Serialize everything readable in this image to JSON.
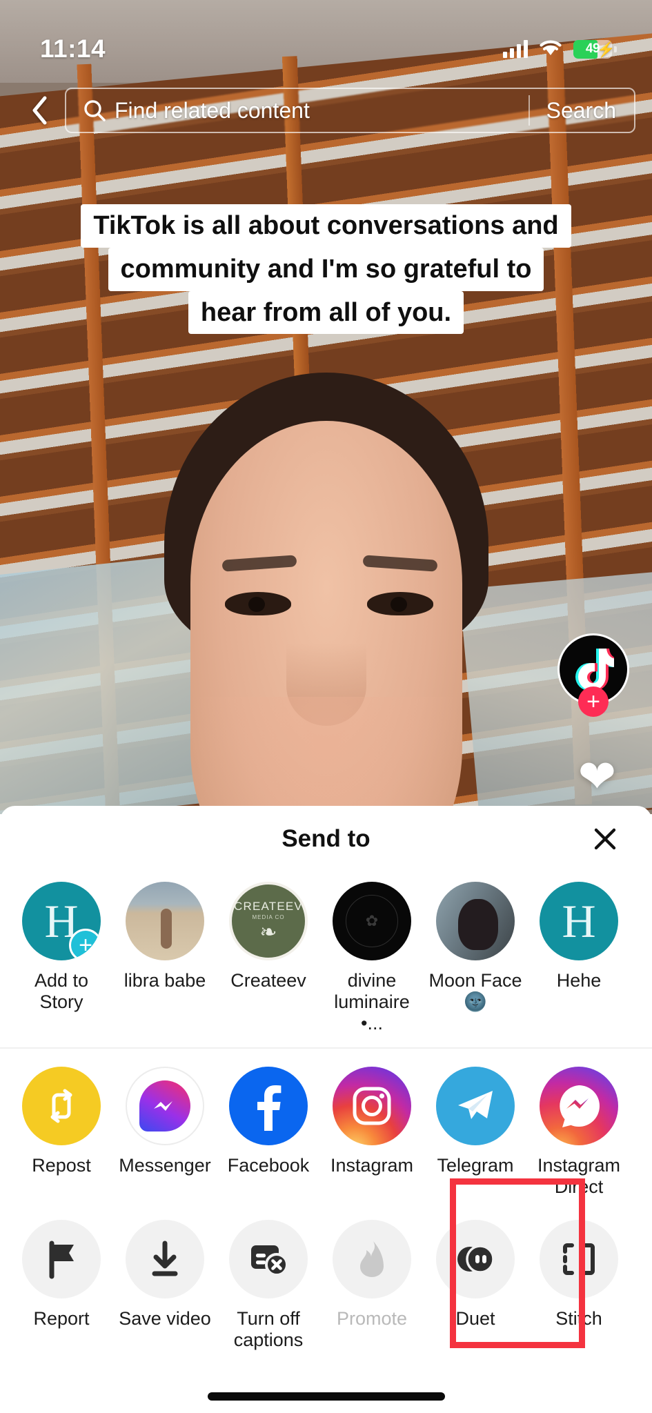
{
  "status_bar": {
    "time": "11:14",
    "battery_percent": "49",
    "battery_charging": true,
    "signal_icon": "cellular-signal-icon",
    "wifi_icon": "wifi-icon"
  },
  "search": {
    "back_icon": "back-chevron-icon",
    "search_icon": "search-icon",
    "placeholder": "Find related content",
    "value": "",
    "button_label": "Search"
  },
  "video": {
    "caption_lines": [
      "TikTok is all about conversations and",
      "community and I'm so grateful to",
      "hear from all of you."
    ],
    "avatar_icon": "tiktok-logo-icon",
    "follow_badge": "+",
    "like_icon": "heart-icon"
  },
  "sheet": {
    "title": "Send to",
    "close_icon": "close-icon",
    "contacts": [
      {
        "label": "Add to Story",
        "avatar": "story-avatar-h",
        "badge": "+"
      },
      {
        "label": "libra babe",
        "avatar": "photo-avatar-beach"
      },
      {
        "label": "Createev",
        "avatar": "logo-avatar-createev",
        "brand": "CREATEEV",
        "brand_sub": "MEDIA CO",
        "leaf": "❧"
      },
      {
        "label": "divine luminaire •...",
        "avatar": "logo-avatar-dark"
      },
      {
        "label": "Moon Face 🌚",
        "avatar": "photo-avatar-moon"
      },
      {
        "label": "Hehe",
        "avatar": "story-avatar-h2"
      }
    ],
    "apps": [
      {
        "label": "Repost",
        "icon": "repost-icon"
      },
      {
        "label": "Messenger",
        "icon": "messenger-icon"
      },
      {
        "label": "Facebook",
        "icon": "facebook-icon"
      },
      {
        "label": "Instagram",
        "icon": "instagram-icon"
      },
      {
        "label": "Telegram",
        "icon": "telegram-icon"
      },
      {
        "label": "Instagram Direct",
        "icon": "instagram-direct-icon"
      }
    ],
    "actions": [
      {
        "label": "Report",
        "icon": "flag-icon",
        "disabled": false,
        "highlighted": false
      },
      {
        "label": "Save video",
        "icon": "download-icon",
        "disabled": false,
        "highlighted": false
      },
      {
        "label": "Turn off captions",
        "icon": "captions-off-icon",
        "disabled": false,
        "highlighted": false
      },
      {
        "label": "Promote",
        "icon": "flame-icon",
        "disabled": true,
        "highlighted": false
      },
      {
        "label": "Duet",
        "icon": "duet-icon",
        "disabled": false,
        "highlighted": true
      },
      {
        "label": "Stitch",
        "icon": "stitch-icon",
        "disabled": false,
        "highlighted": false
      }
    ]
  },
  "highlight": {
    "color": "#f4333f"
  },
  "colors": {
    "accent_red": "#fe2c55",
    "teal": "#12919f",
    "battery_green": "#2ad158",
    "repost_yellow": "#f5cb23",
    "facebook_blue": "#0a66ef",
    "telegram_blue": "#35a8dd"
  },
  "home_indicator": "home-indicator"
}
